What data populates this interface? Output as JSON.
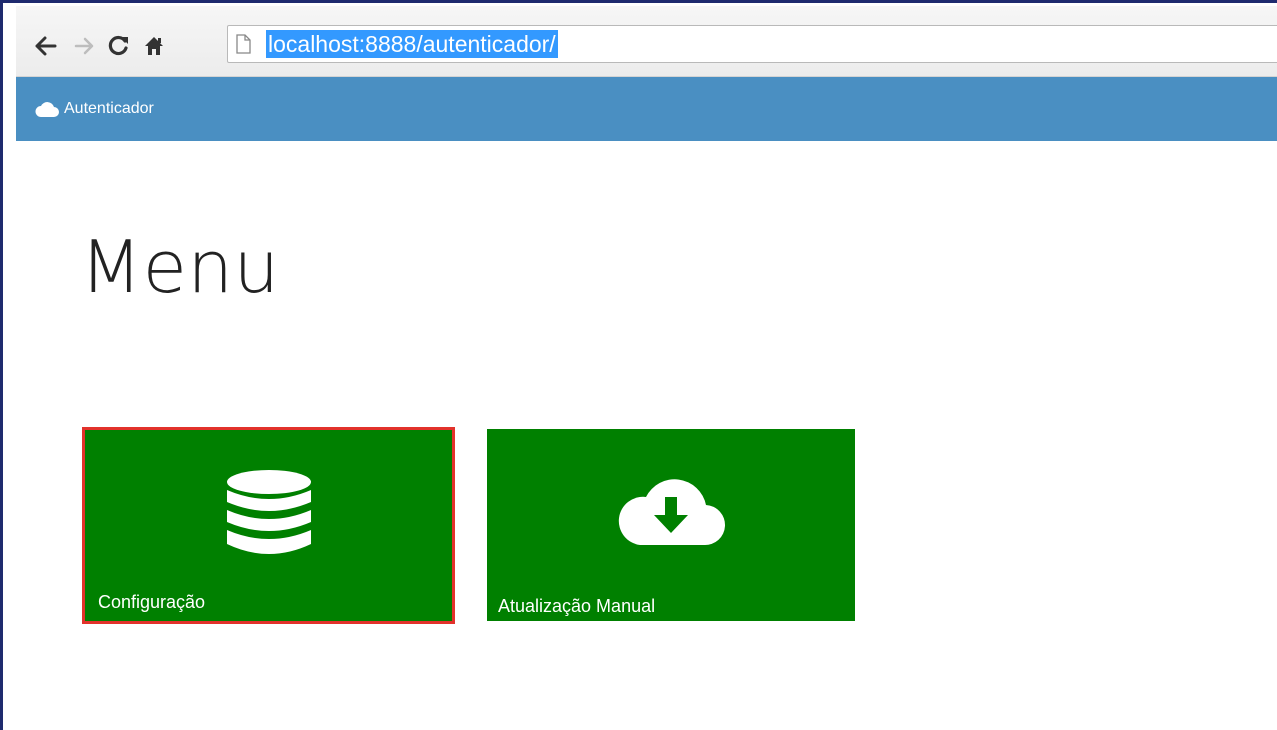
{
  "browser": {
    "url": "localhost:8888/autenticador/",
    "icons": {
      "back": "arrow-left-icon",
      "forward": "arrow-right-icon",
      "reload": "reload-icon",
      "home": "home-icon",
      "page": "page-icon"
    }
  },
  "navbar": {
    "brand_label": "Autenticador",
    "brand_icon": "cloud-icon",
    "background": "#4a8fc2"
  },
  "main": {
    "title": "Menu",
    "tiles": [
      {
        "label": "Configuração",
        "icon": "database-icon",
        "color": "#008000",
        "highlighted": true,
        "highlight_color": "#e2322b"
      },
      {
        "label": "Atualização Manual",
        "icon": "cloud-download-icon",
        "color": "#008000",
        "highlighted": false
      }
    ]
  }
}
